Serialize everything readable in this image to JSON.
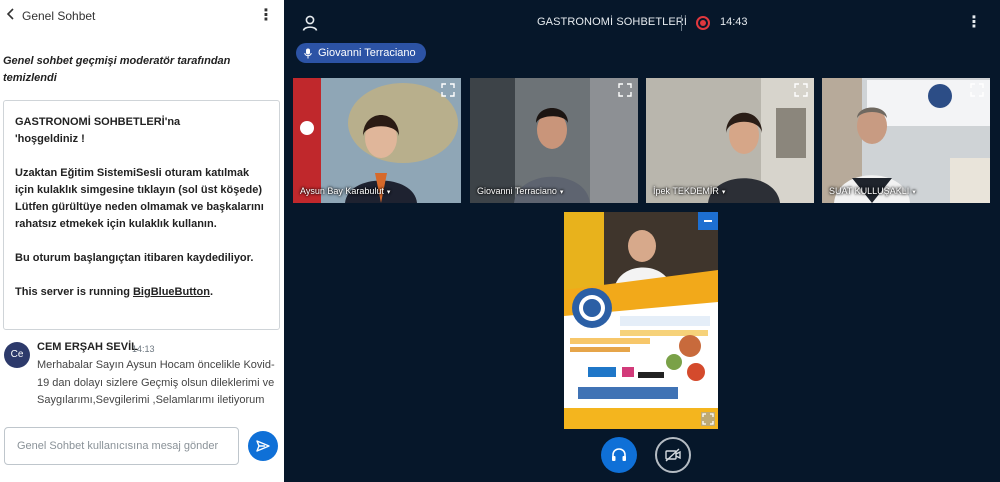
{
  "chat": {
    "title": "Genel Sohbet",
    "cleared_notice": "Genel sohbet geçmişi moderatör tarafından temizlendi",
    "welcome": {
      "line1": "GASTRONOMİ SOHBETLERİ'na",
      "line2": "'hoşgeldiniz !",
      "para2": "Uzaktan Eğitim SistemiSesli oturam katılmak için kulaklık simgesine tıklayın (sol üst köşede) Lütfen gürültüye neden olmamak ve başkalarını rahatsız etmekek için kulaklık kullanın.",
      "para3": "Bu oturum başlangıçtan itibaren kaydediliyor.",
      "server_prefix": "This server is running ",
      "server_link": "BigBlueButton",
      "server_suffix": "."
    },
    "message": {
      "avatar": "Ce",
      "author": "CEM ERŞAH SEVİL",
      "time": "14:13",
      "text": "Merhabalar Sayın Aysun Hocam öncelikle Kovid-19 dan dolayı sizlere Geçmiş olsun dileklerimi ve Saygılarımı,Sevgilerimi ,Selamlarımı iletiyorum"
    },
    "input_placeholder": "Genel Sohbet kullanıcısına mesaj gönder"
  },
  "header": {
    "room_title": "GASTRONOMİ SOHBETLERİ",
    "recording_time": "14:43"
  },
  "talking_indicator": "Giovanni Terraciano",
  "participants": [
    {
      "name": "Aysun Bay Karabulut"
    },
    {
      "name": "Giovanni Terraciano"
    },
    {
      "name": "İpek TEKDEMİR"
    },
    {
      "name": "SUAT KULLUŞAKLI"
    }
  ],
  "colors": {
    "accent": "#0f70d7",
    "background": "#06172a",
    "record": "#e0383e",
    "talker_pill": "#2c53a5"
  },
  "icons": {
    "back": "chevron-left-icon",
    "menu": "more-vertical-icon",
    "send": "send-icon",
    "user": "user-icon",
    "record": "record-icon",
    "mic": "microphone-icon",
    "fullscreen": "fullscreen-icon",
    "audio": "headphones-icon",
    "video": "camera-off-icon"
  }
}
